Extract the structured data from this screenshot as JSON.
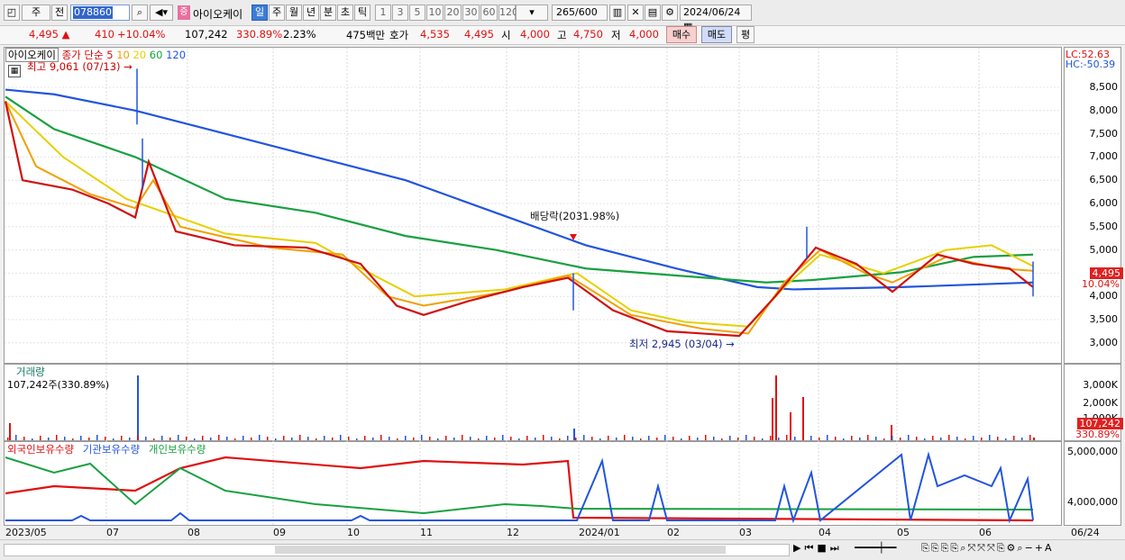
{
  "toolbar": {
    "period_type": "주",
    "prev_label": "전",
    "stock_code": "078860",
    "stock_name_badge": "증",
    "stock_name": "아이오케이",
    "periods": [
      "일",
      "주",
      "월",
      "년",
      "분",
      "초",
      "틱"
    ],
    "active_period": "일",
    "intervals": [
      "1",
      "3",
      "5",
      "10",
      "20",
      "30",
      "60",
      "120"
    ],
    "count_value": "265",
    "count_total": "/600",
    "date": "2024/06/24"
  },
  "quote": {
    "price": "4,495",
    "change": "410",
    "change_pct": "+10.04%",
    "volume": "107,242",
    "volume_ratio": "330.89%",
    "turnover": "2.23%",
    "amount": "475백만",
    "bid_label": "호가",
    "bid1": "4,535",
    "bid2": "4,495",
    "open_label": "시",
    "open": "4,000",
    "high_label": "고",
    "high": "4,750",
    "low_label": "저",
    "low": "4,000",
    "buy_label": "매수",
    "sell_label": "매도",
    "even_label": "평"
  },
  "price_panel": {
    "name": "아이오케이",
    "ma_title": "종가 단순",
    "ma_periods": [
      "5",
      "10",
      "20",
      "60",
      "120"
    ],
    "ma_colors": [
      "#d01010",
      "#f0a000",
      "#e6d000",
      "#18a040",
      "#2255dd"
    ],
    "high_annotation": "최고 9,061 (07/13)",
    "low_annotation": "최저 2,945 (03/04)",
    "dividend_annotation": "배당락(2031.98%)",
    "lc": "LC:52.63",
    "hc": "HC:-50.39",
    "y_ticks": [
      "8,500",
      "8,000",
      "7,500",
      "7,000",
      "6,500",
      "6,000",
      "5,500",
      "5,000",
      "4,500",
      "4,000",
      "3,500",
      "3,000"
    ],
    "current_price_tag": "4,495",
    "current_pct_tag": "10.04%"
  },
  "volume_panel": {
    "title": "거래량",
    "value": "107,242주(330.89%)",
    "y_ticks": [
      "3,000K",
      "2,000K",
      "1,000K"
    ],
    "tag_value": "107,242",
    "tag_pct": "330.89%"
  },
  "holding_panel": {
    "foreign": "외국인보유수량",
    "institution": "기관보유수량",
    "individual": "개인보유수량",
    "y_ticks": [
      "5,000,000",
      "4,000,000"
    ]
  },
  "x_axis": [
    "2023/05",
    "07",
    "08",
    "09",
    "10",
    "11",
    "12",
    "2024/01",
    "02",
    "03",
    "04",
    "05",
    "06",
    "06/24"
  ]
}
